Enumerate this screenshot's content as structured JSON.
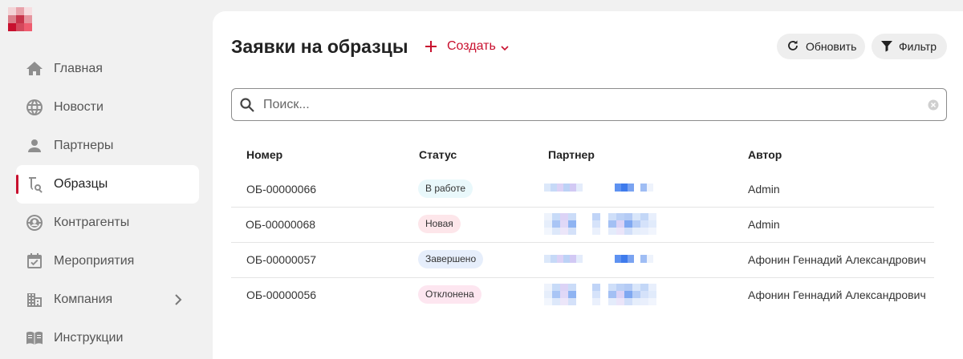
{
  "app": {
    "logo_colors": [
      "#f3d3d6",
      "#e8a2aa",
      "#f7dde0",
      "#db7f8a",
      "#c8344a",
      "#e6949e",
      "#c8102e",
      "#d4485c",
      "#ef5c6f"
    ]
  },
  "sidebar": {
    "items": [
      {
        "label": "Главная",
        "icon": "home-icon"
      },
      {
        "label": "Новости",
        "icon": "globe-icon"
      },
      {
        "label": "Партнеры",
        "icon": "person-icon"
      },
      {
        "label": "Образцы",
        "icon": "sample-search-icon",
        "active": true
      },
      {
        "label": "Контрагенты",
        "icon": "contractor-icon"
      },
      {
        "label": "Мероприятия",
        "icon": "calendar-icon"
      },
      {
        "label": "Компания",
        "icon": "building-icon",
        "has_submenu": true
      },
      {
        "label": "Инструкции",
        "icon": "book-icon"
      }
    ]
  },
  "header": {
    "title": "Заявки на образцы",
    "create_label": "Создать",
    "refresh_label": "Обновить",
    "filter_label": "Фильтр"
  },
  "search": {
    "placeholder": "Поиск...",
    "value": ""
  },
  "table": {
    "columns": [
      "Номер",
      "Статус",
      "Партнер",
      "Автор"
    ],
    "rows": [
      {
        "number": "ОБ-00000066",
        "status": "В работе",
        "status_color": "#e9f8fb",
        "partner_redacted": true,
        "author": "Admin"
      },
      {
        "number": "ОБ-00000068",
        "status": "Новая",
        "status_color": "#fde6ea",
        "partner_redacted": true,
        "author": "Admin"
      },
      {
        "number": "ОБ-00000057",
        "status": "Завершено",
        "status_color": "#e6eefb",
        "partner_redacted": true,
        "author": "Афонин Геннадий Александрович"
      },
      {
        "number": "ОБ-00000056",
        "status": "Отклонена",
        "status_color": "#fde6f0",
        "partner_redacted": true,
        "author": "Афонин Геннадий Александрович"
      }
    ]
  },
  "colors": {
    "accent": "#c8102e",
    "active_marker": "#c8102e"
  }
}
